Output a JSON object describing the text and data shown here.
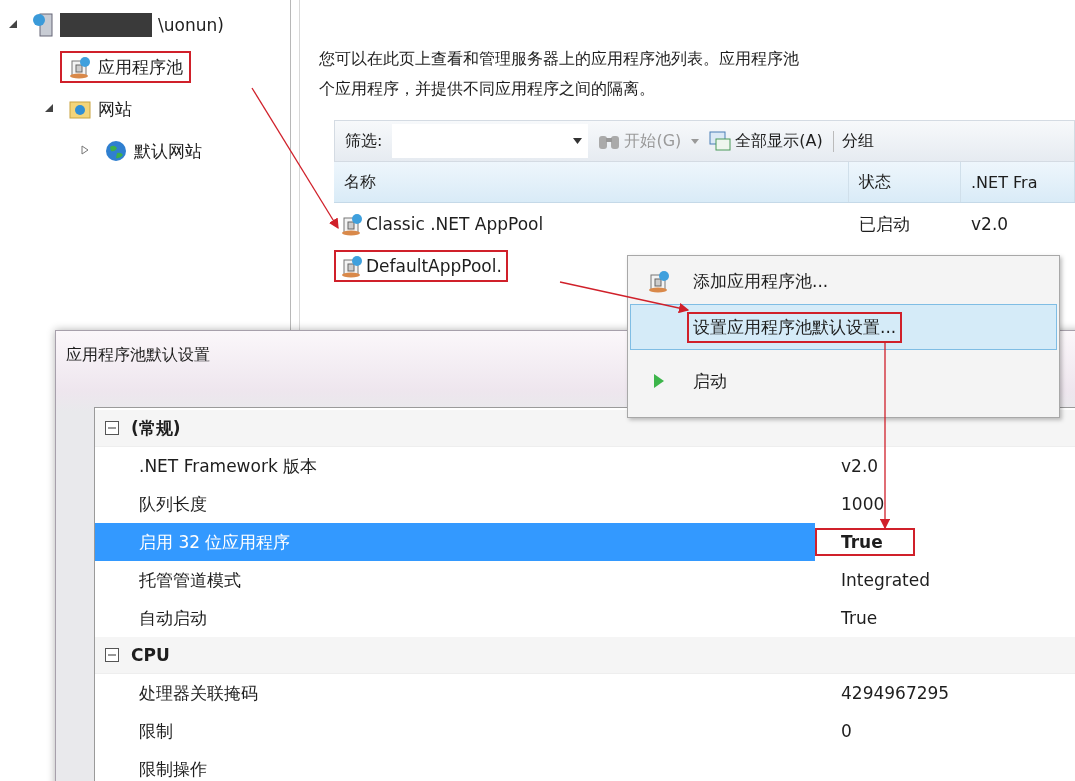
{
  "tree": {
    "items": [
      {
        "label": "\\uonun)",
        "kind": "server",
        "redacted": true,
        "expanded": true,
        "children": [
          {
            "label": "应用程序池",
            "kind": "pool",
            "annotated": true
          },
          {
            "label": "网站",
            "kind": "sites",
            "expanded": true,
            "children": [
              {
                "label": "默认网站",
                "kind": "globe",
                "expanded": false
              }
            ]
          }
        ]
      }
    ]
  },
  "description": [
    "您可以在此页上查看和管理服务器上的应用程序池列表。应用程序池",
    "个应用程序，并提供不同应用程序之间的隔离。"
  ],
  "toolbar": {
    "filter_label": "筛选:",
    "start_label": "开始(G)",
    "show_all_label": "全部显示(A)",
    "group_label": "分组"
  },
  "table": {
    "columns": [
      "名称",
      "状态",
      ".NET Fra"
    ],
    "rows": [
      {
        "cells": [
          "Classic .NET AppPool",
          "已启动",
          "v2.0"
        ]
      },
      {
        "cells": [
          "DefaultAppPool."
        ],
        "annotated": true
      }
    ]
  },
  "context_menu": {
    "items": [
      {
        "label": "添加应用程序池...",
        "kind": "pool",
        "selected": false
      },
      {
        "label": "设置应用程序池默认设置...",
        "kind": "none",
        "selected": true,
        "annotated": true
      },
      {
        "label": "启动",
        "kind": "play",
        "selected": false
      }
    ]
  },
  "dialog": {
    "title": "应用程序池默认设置",
    "categories": [
      {
        "name": "(常规)",
        "expanded": true,
        "properties": [
          {
            "label": ".NET Framework 版本",
            "value": "v2.0",
            "selected": false
          },
          {
            "label": "队列长度",
            "value": "1000",
            "selected": false
          },
          {
            "label": "启用 32 位应用程序",
            "value": "True",
            "selected": true,
            "annotated": true
          },
          {
            "label": "托管管道模式",
            "value": "Integrated",
            "selected": false
          },
          {
            "label": "自动启动",
            "value": "True",
            "selected": false
          }
        ]
      },
      {
        "name": "CPU",
        "expanded": true,
        "properties": [
          {
            "label": "处理器关联掩码",
            "value": "4294967295",
            "selected": false
          },
          {
            "label": "限制",
            "value": "0",
            "selected": false
          },
          {
            "label": "限制操作",
            "selected": false
          }
        ]
      }
    ]
  }
}
